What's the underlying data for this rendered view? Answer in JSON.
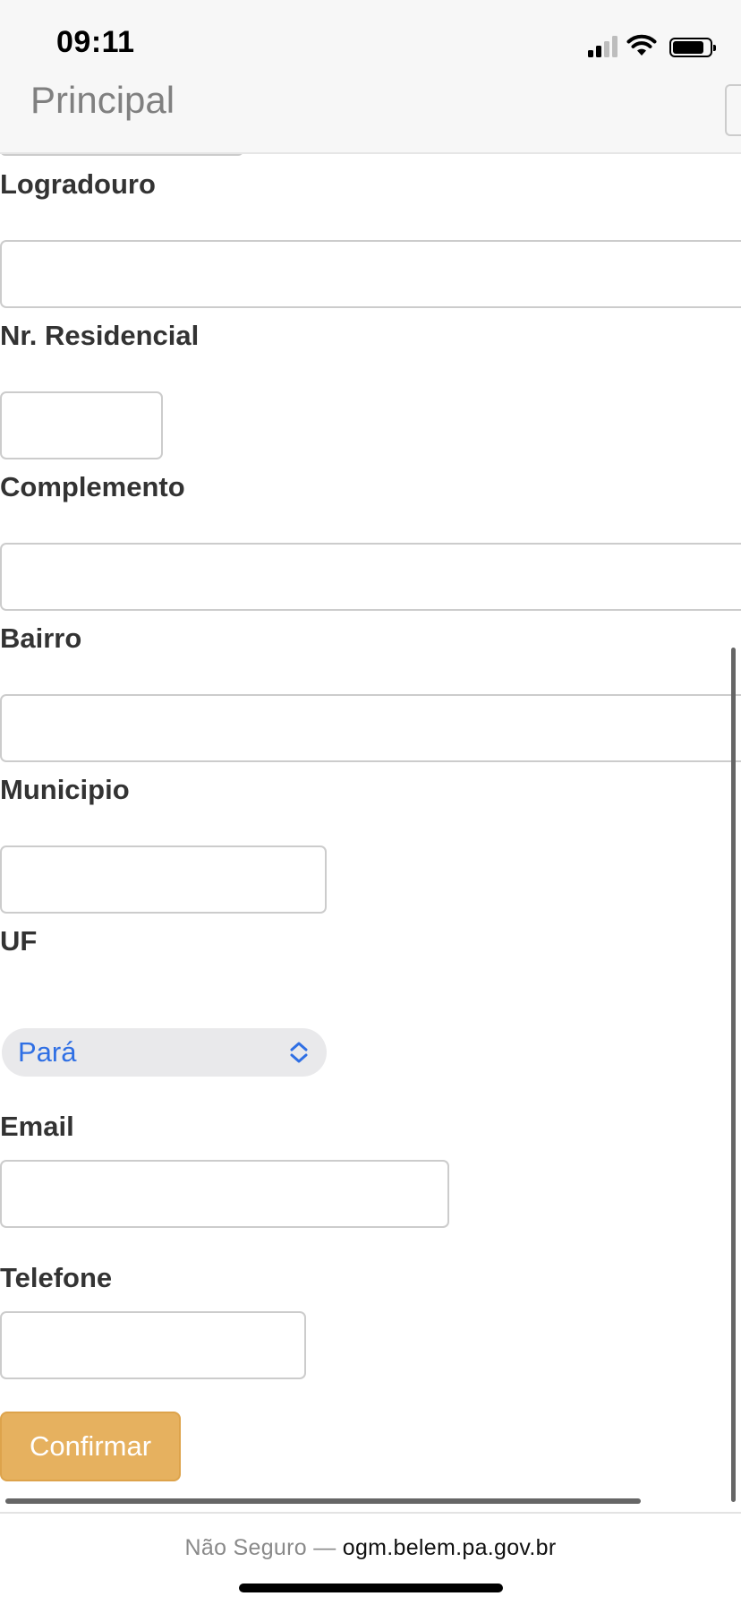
{
  "status_bar": {
    "time": "09:11"
  },
  "header": {
    "title": "Principal"
  },
  "form": {
    "fields": [
      {
        "id": "logradouro",
        "label": "Logradouro",
        "value": ""
      },
      {
        "id": "nr-residencial",
        "label": "Nr. Residencial",
        "value": ""
      },
      {
        "id": "complemento",
        "label": "Complemento",
        "value": ""
      },
      {
        "id": "bairro",
        "label": "Bairro",
        "value": ""
      },
      {
        "id": "municipio",
        "label": "Municipio",
        "value": ""
      },
      {
        "id": "uf",
        "label": "UF",
        "selected": "Pará"
      },
      {
        "id": "email",
        "label": "Email",
        "value": ""
      },
      {
        "id": "telefone",
        "label": "Telefone",
        "value": ""
      }
    ],
    "submit_label": "Confirmar"
  },
  "address_bar": {
    "security_text": "Não Seguro —",
    "host": "ogm.belem.pa.gov.br"
  },
  "colors": {
    "accent_button": "#e6b15f",
    "select_text": "#2f6fe4",
    "label_text": "#333333",
    "header_title": "#808080"
  },
  "icons": [
    "cellular-signal-icon",
    "wifi-icon",
    "battery-icon",
    "select-chevrons-icon"
  ]
}
